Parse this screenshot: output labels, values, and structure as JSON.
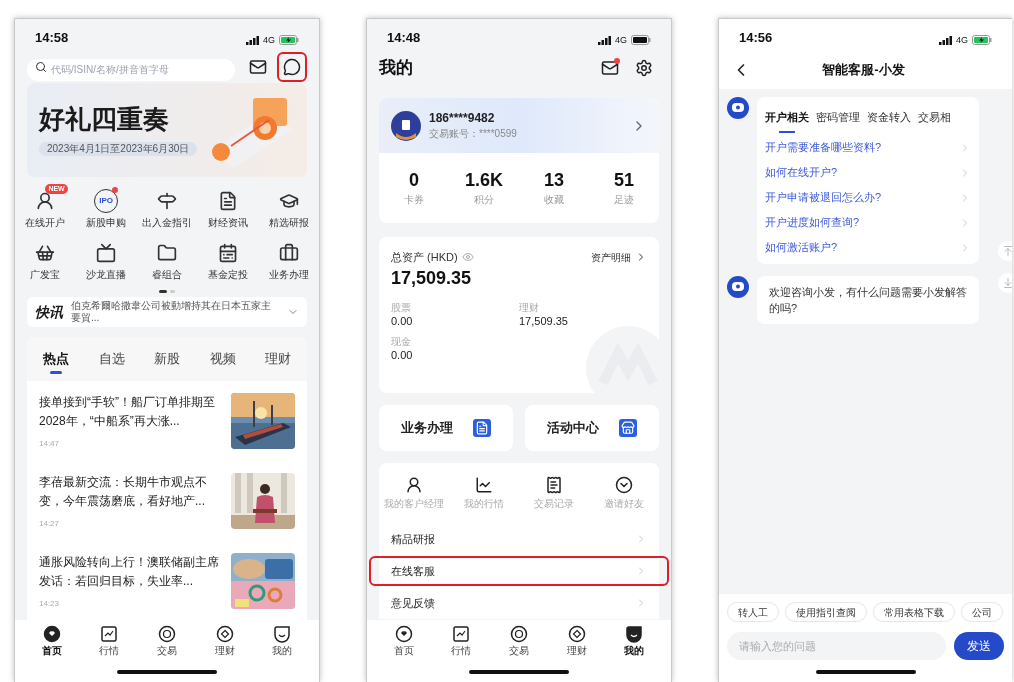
{
  "home_screen": {
    "status_bar": {
      "time": "14:58",
      "network": "4G",
      "charging": true
    },
    "search": {
      "placeholder": "代码/ISIN/名称/拼音首字母"
    },
    "header_icons": [
      {
        "kind": "mail",
        "dot": false,
        "highlighted": false
      },
      {
        "kind": "support",
        "dot": false,
        "highlighted": true
      }
    ],
    "banner": {
      "title": "好礼四重奏",
      "subtitle": "2023年4月1日至2023年6月30日"
    },
    "shortcuts": [
      {
        "label": "在线开户",
        "badge": "NEW"
      },
      {
        "label": "新股申购",
        "icon_text": "IPO",
        "dot": true
      },
      {
        "label": "出入金指引"
      },
      {
        "label": "财经资讯"
      },
      {
        "label": "精选研报"
      },
      {
        "label": "广发宝"
      },
      {
        "label": "沙龙直播"
      },
      {
        "label": "睿组合"
      },
      {
        "label": "基金定投"
      },
      {
        "label": "业务办理"
      }
    ],
    "pager": [
      {
        "selected": true
      },
      {
        "selected": false
      }
    ],
    "ticker": {
      "label": "快讯",
      "text": "伯克希爾哈撒韋公司被動增持其在日本五家主要貿..."
    },
    "tabs": [
      {
        "label": "热点",
        "selected": true
      },
      {
        "label": "自选",
        "selected": false
      },
      {
        "label": "新股",
        "selected": false
      },
      {
        "label": "视频",
        "selected": false
      },
      {
        "label": "理财",
        "selected": false
      }
    ],
    "news": [
      {
        "title": "接单接到“手软”！船厂订单排期至2028年，“中船系”再大涨...",
        "time": "14:47"
      },
      {
        "title": "李蓓最新交流：长期牛市观点不变，今年震荡磨底，看好地产...",
        "time": "14:27"
      },
      {
        "title": "通胀风险转向上行！澳联储副主席发话：若回归目标，失业率...",
        "time": "14:23"
      }
    ],
    "nav": [
      {
        "label": "首页",
        "selected": true
      },
      {
        "label": "行情",
        "selected": false
      },
      {
        "label": "交易",
        "selected": false
      },
      {
        "label": "理财",
        "selected": false
      },
      {
        "label": "我的",
        "selected": false
      }
    ]
  },
  "profile_screen": {
    "status_bar": {
      "time": "14:48",
      "network": "4G",
      "charging": false
    },
    "title": "我的",
    "header_icons": [
      {
        "kind": "mail",
        "dot": true,
        "highlighted": false
      },
      {
        "kind": "settings",
        "dot": false,
        "highlighted": false
      }
    ],
    "account": {
      "phone": "186****9482",
      "account_no": "交易账号：****0599"
    },
    "stats": [
      {
        "value": "0",
        "label": "卡券"
      },
      {
        "value": "1.6K",
        "label": "积分"
      },
      {
        "value": "13",
        "label": "收藏"
      },
      {
        "value": "51",
        "label": "足迹"
      }
    ],
    "assets": {
      "label": "总资产 (HKD)",
      "detail_link": "资产明细",
      "total": "17,509.35",
      "items": [
        {
          "label": "股票",
          "value": "0.00"
        },
        {
          "label": "理财",
          "value": "17,509.35"
        },
        {
          "label": "现金",
          "value": "0.00"
        }
      ]
    },
    "feature_cards": [
      {
        "label": "业务办理"
      },
      {
        "label": "活动中心"
      }
    ],
    "tools": [
      {
        "label": "我的客户经理"
      },
      {
        "label": "我的行情"
      },
      {
        "label": "交易记录"
      },
      {
        "label": "邀请好友"
      }
    ],
    "menu": [
      {
        "label": "精品研报",
        "highlighted": false
      },
      {
        "label": "在线客服",
        "highlighted": true
      },
      {
        "label": "意见反馈",
        "highlighted": false
      }
    ],
    "nav": [
      {
        "label": "首页",
        "selected": false
      },
      {
        "label": "行情",
        "selected": false
      },
      {
        "label": "交易",
        "selected": false
      },
      {
        "label": "理财",
        "selected": false
      },
      {
        "label": "我的",
        "selected": true
      }
    ]
  },
  "chat_screen": {
    "status_bar": {
      "time": "14:56",
      "network": "4G",
      "charging": true
    },
    "title": "智能客服-小发",
    "topic_tabs": [
      {
        "label": "开户相关",
        "selected": true
      },
      {
        "label": "密码管理",
        "selected": false
      },
      {
        "label": "资金转入",
        "selected": false
      },
      {
        "label": "交易相",
        "selected": false
      }
    ],
    "questions": [
      "开户需要准备哪些资料?",
      "如何在线开户?",
      "开户申请被退回怎么办?",
      "开户进度如何查询?",
      "如何激活账户?"
    ],
    "welcome": "欢迎咨询小发，有什么问题需要小发解答的吗?",
    "quick_replies": [
      "转人工",
      "使用指引查阅",
      "常用表格下载",
      "公司"
    ],
    "input": {
      "placeholder": "请输入您的问题"
    },
    "send_button": "发送"
  }
}
